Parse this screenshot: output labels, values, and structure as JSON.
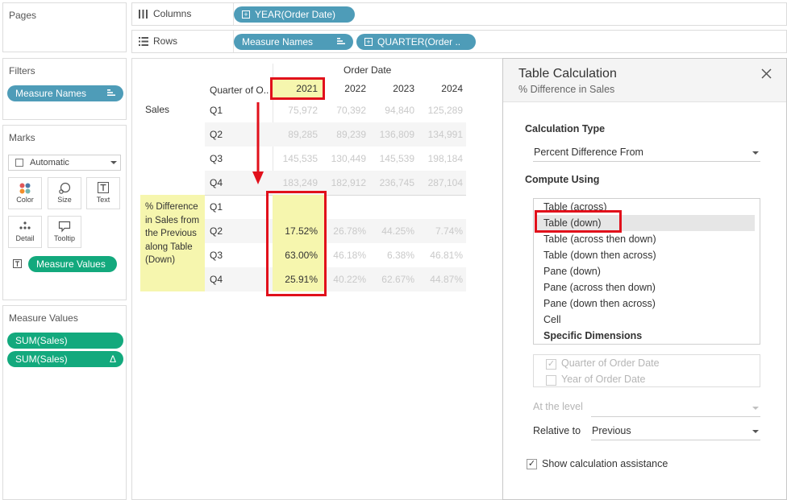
{
  "left": {
    "pages": {
      "title": "Pages"
    },
    "filters": {
      "title": "Filters",
      "pills": [
        {
          "label": "Measure Names",
          "icon": "sort-bars-icon"
        }
      ]
    },
    "marks": {
      "title": "Marks",
      "type_value": "Automatic",
      "buttons": [
        {
          "label": "Color",
          "icon": "color-dots-icon"
        },
        {
          "label": "Size",
          "icon": "size-circle-icon"
        },
        {
          "label": "Text",
          "icon": "text-T-icon"
        },
        {
          "label": "Detail",
          "icon": "detail-dots-icon"
        },
        {
          "label": "Tooltip",
          "icon": "tooltip-bubble-icon"
        }
      ],
      "field_pill": {
        "label": "Measure Values",
        "icon": "text-T-icon"
      }
    },
    "measure_values": {
      "title": "Measure Values",
      "pills": [
        {
          "label": "SUM(Sales)"
        },
        {
          "label": "SUM(Sales)",
          "badge": "Δ"
        }
      ]
    }
  },
  "shelves": {
    "columns": {
      "label": "Columns",
      "pill": "YEAR(Order Date)"
    },
    "rows": {
      "label": "Rows",
      "pill1": "Measure Names",
      "pill2": "QUARTER(Order .."
    }
  },
  "table": {
    "header_top": "Order Date",
    "row_header_col": "Quarter of O..",
    "years": [
      "2021",
      "2022",
      "2023",
      "2024"
    ],
    "quarters": [
      "Q1",
      "Q2",
      "Q3",
      "Q4"
    ],
    "sections": [
      {
        "label": "Sales",
        "rows": [
          [
            "75,972",
            "70,392",
            "94,840",
            "125,289"
          ],
          [
            "89,285",
            "89,239",
            "136,809",
            "134,991"
          ],
          [
            "145,535",
            "130,449",
            "145,539",
            "198,184"
          ],
          [
            "183,249",
            "182,912",
            "236,745",
            "287,104"
          ]
        ]
      },
      {
        "label": "% Difference in Sales from the Previous along Table (Down)",
        "rows": [
          [
            "",
            "",
            "",
            ""
          ],
          [
            "17.52%",
            "26.78%",
            "44.25%",
            "7.74%"
          ],
          [
            "63.00%",
            "46.18%",
            "6.38%",
            "46.81%"
          ],
          [
            "25.91%",
            "40.22%",
            "62.67%",
            "44.87%"
          ]
        ]
      }
    ]
  },
  "panel": {
    "title": "Table Calculation",
    "subtitle": "% Difference in Sales",
    "calc_type_title": "Calculation Type",
    "calc_type_value": "Percent Difference From",
    "compute_using_title": "Compute Using",
    "compute_options": [
      "Table (across)",
      "Table (down)",
      "Table (across then down)",
      "Table (down then across)",
      "Pane (down)",
      "Pane (across then down)",
      "Pane (down then across)",
      "Cell",
      "Specific Dimensions"
    ],
    "selected_option": "Table (down)",
    "dimensions": [
      {
        "label": "Quarter of Order Date",
        "checked": true
      },
      {
        "label": "Year of Order Date",
        "checked": false
      }
    ],
    "at_level_label": "At the level",
    "relative_label": "Relative to",
    "relative_value": "Previous",
    "assist_label": "Show calculation assistance",
    "assist_checked": true
  },
  "colors": {
    "highlight": "#f6f6ae",
    "annotation_red": "#e1101b",
    "pill_blue": "#4e9cb8",
    "pill_green": "#13a97d"
  }
}
